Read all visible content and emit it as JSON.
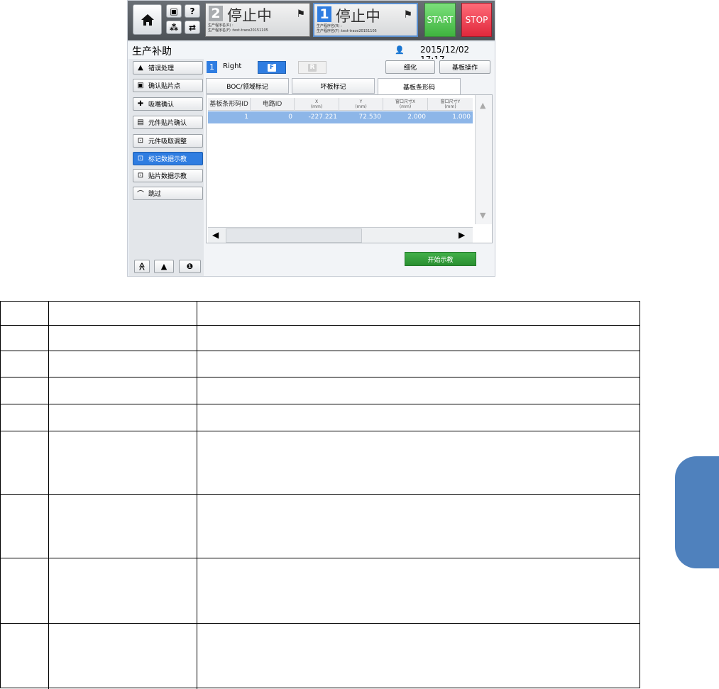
{
  "colors": {
    "accent_blue": "#2f7de1",
    "start_green": "#3fb33f",
    "stop_red": "#e0283c",
    "teach_green": "#2a8f31",
    "selected_row": "#8db6e8",
    "side_tab": "#4f81bd"
  },
  "topbar": {
    "home_icon": "home-icon",
    "small_buttons": [
      "▣",
      "?",
      "⁂",
      "⇄"
    ],
    "status2": {
      "number": "2",
      "text": "停止中",
      "icon": "document-icon",
      "line1": "生产程序名(R) :",
      "line2": "生产程序名(F) :test-trace20151105"
    },
    "status1": {
      "number": "1",
      "text": "停止中",
      "icon": "document-icon",
      "line1": "生产程序名(R) :",
      "line2": "生产程序名(F) :test-trace20151105"
    },
    "start_label": "START",
    "stop_label": "STOP"
  },
  "header": {
    "title": "生产补助",
    "datetime": "2015/12/02 17:17"
  },
  "menu": {
    "items": [
      {
        "icon": "▲",
        "label": "错误处理"
      },
      {
        "icon": "▣",
        "label": "确认贴片点"
      },
      {
        "icon": "✚",
        "label": "吸嘴确认"
      },
      {
        "icon": "▤",
        "label": "元件贴片确认"
      },
      {
        "icon": "⊡",
        "label": "元件吸取调整"
      },
      {
        "icon": "⊡",
        "label": "标记数据示教"
      },
      {
        "icon": "⊡",
        "label": "贴片数据示教"
      },
      {
        "icon": "⌒",
        "label": "跳过"
      }
    ],
    "bottom": [
      "≪",
      "▲",
      "❶"
    ]
  },
  "main": {
    "lane_number": "1",
    "lane_label": "Right",
    "f_label": "F",
    "r_label": "R",
    "detail_button": "细化",
    "board_ops_button": "基板操作",
    "tabs": [
      "BOC/领域标记",
      "坏板标记",
      "基板条形码"
    ],
    "table": {
      "headers": [
        {
          "title": "基板条形码ID",
          "unit": ""
        },
        {
          "title": "电路ID",
          "unit": ""
        },
        {
          "title": "X",
          "unit": "(mm)"
        },
        {
          "title": "Y",
          "unit": "(mm)"
        },
        {
          "title": "窗口尺寸X",
          "unit": "(mm)"
        },
        {
          "title": "窗口尺寸Y",
          "unit": "(mm)"
        }
      ],
      "rows": [
        [
          "1",
          "0",
          "-227.221",
          "72.530",
          "2.000",
          "1.000"
        ]
      ]
    },
    "start_teach_button": "开始示教"
  }
}
